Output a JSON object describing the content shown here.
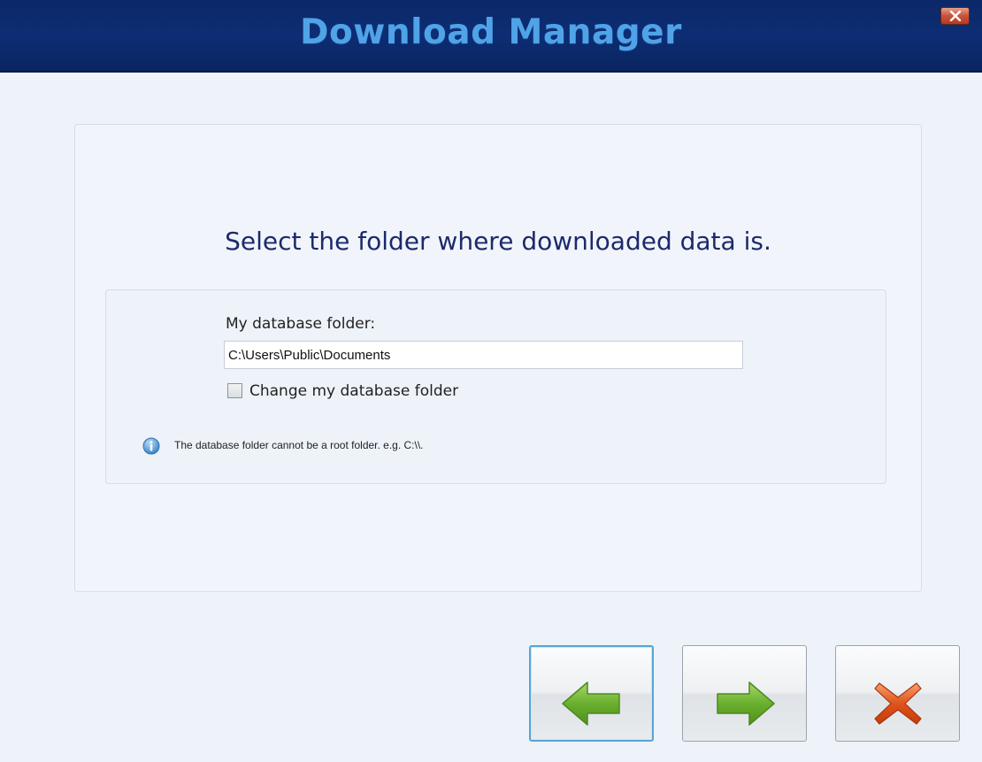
{
  "window": {
    "title": "Download Manager",
    "close_icon": "close-icon",
    "close_glyph": "✕"
  },
  "main": {
    "heading": "Select the folder where downloaded data is.",
    "folder_label": "My database folder:",
    "folder_value": "C:\\Users\\Public\\Documents",
    "checkbox_label": "Change my database folder",
    "checkbox_checked": false,
    "info_icon": "info-icon",
    "info_text": "The database folder cannot be a root folder. e.g. C:\\\\."
  },
  "footer": {
    "back_icon": "arrow-left-icon",
    "next_icon": "arrow-right-icon",
    "cancel_icon": "cancel-x-icon"
  },
  "colors": {
    "titlebar": "#0d2d74",
    "title_text": "#4fa3e6",
    "heading_text": "#1c2a6b",
    "arrow_green": "#6ab02e",
    "cancel_orange": "#e0531c",
    "focus_border": "#56a6d6"
  }
}
